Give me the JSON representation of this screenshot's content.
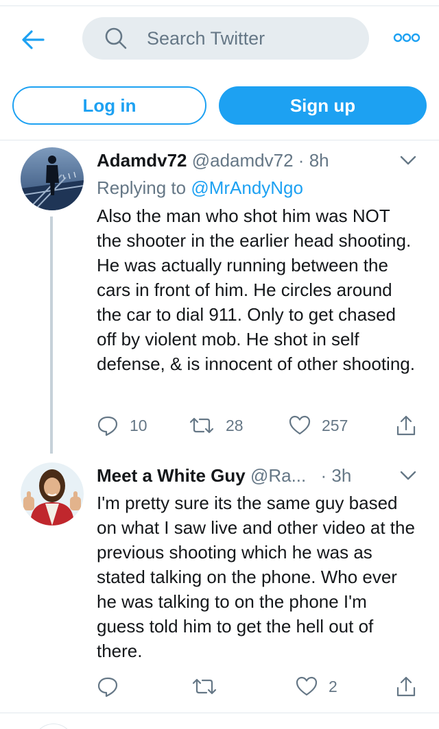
{
  "app": {
    "search_placeholder": "Search Twitter",
    "login_label": "Log in",
    "signup_label": "Sign up",
    "accent_color": "#1da1f2"
  },
  "tweets": [
    {
      "name": "Adamdv72",
      "handle": "@adamdv72",
      "separator": "·",
      "time": "8h",
      "reply_prefix": "Replying to",
      "reply_to": "@MrAndyNgo",
      "text": "Also the man who shot him was NOT the shooter in the earlier head shooting. He was actually running between the cars in front of him. He circles around the car to dial 911. Only to get chased off by violent mob. He shot in self defense, & is innocent of other shooting.",
      "replies": "10",
      "retweets": "28",
      "likes": "257",
      "avatar_icon": "person-on-bridge-photo"
    },
    {
      "name": "Meet a White Guy",
      "handle": "@Ra...",
      "separator": "·",
      "time": "3h",
      "text": "I'm pretty sure its the same guy based on what I saw live and other video at the previous shooting which he was as stated talking on the phone. Who ever he was talking to on the phone I'm guess told him to get the hell out of there.",
      "replies": "",
      "retweets": "",
      "likes": "2",
      "avatar_icon": "thumbs-up-man-photo"
    }
  ],
  "icons": {
    "back": "back-arrow-icon",
    "search": "search-icon",
    "more": "more-options-icon",
    "caret": "chevron-down-icon",
    "reply": "reply-icon",
    "retweet": "retweet-icon",
    "like": "heart-icon",
    "share": "share-icon"
  }
}
